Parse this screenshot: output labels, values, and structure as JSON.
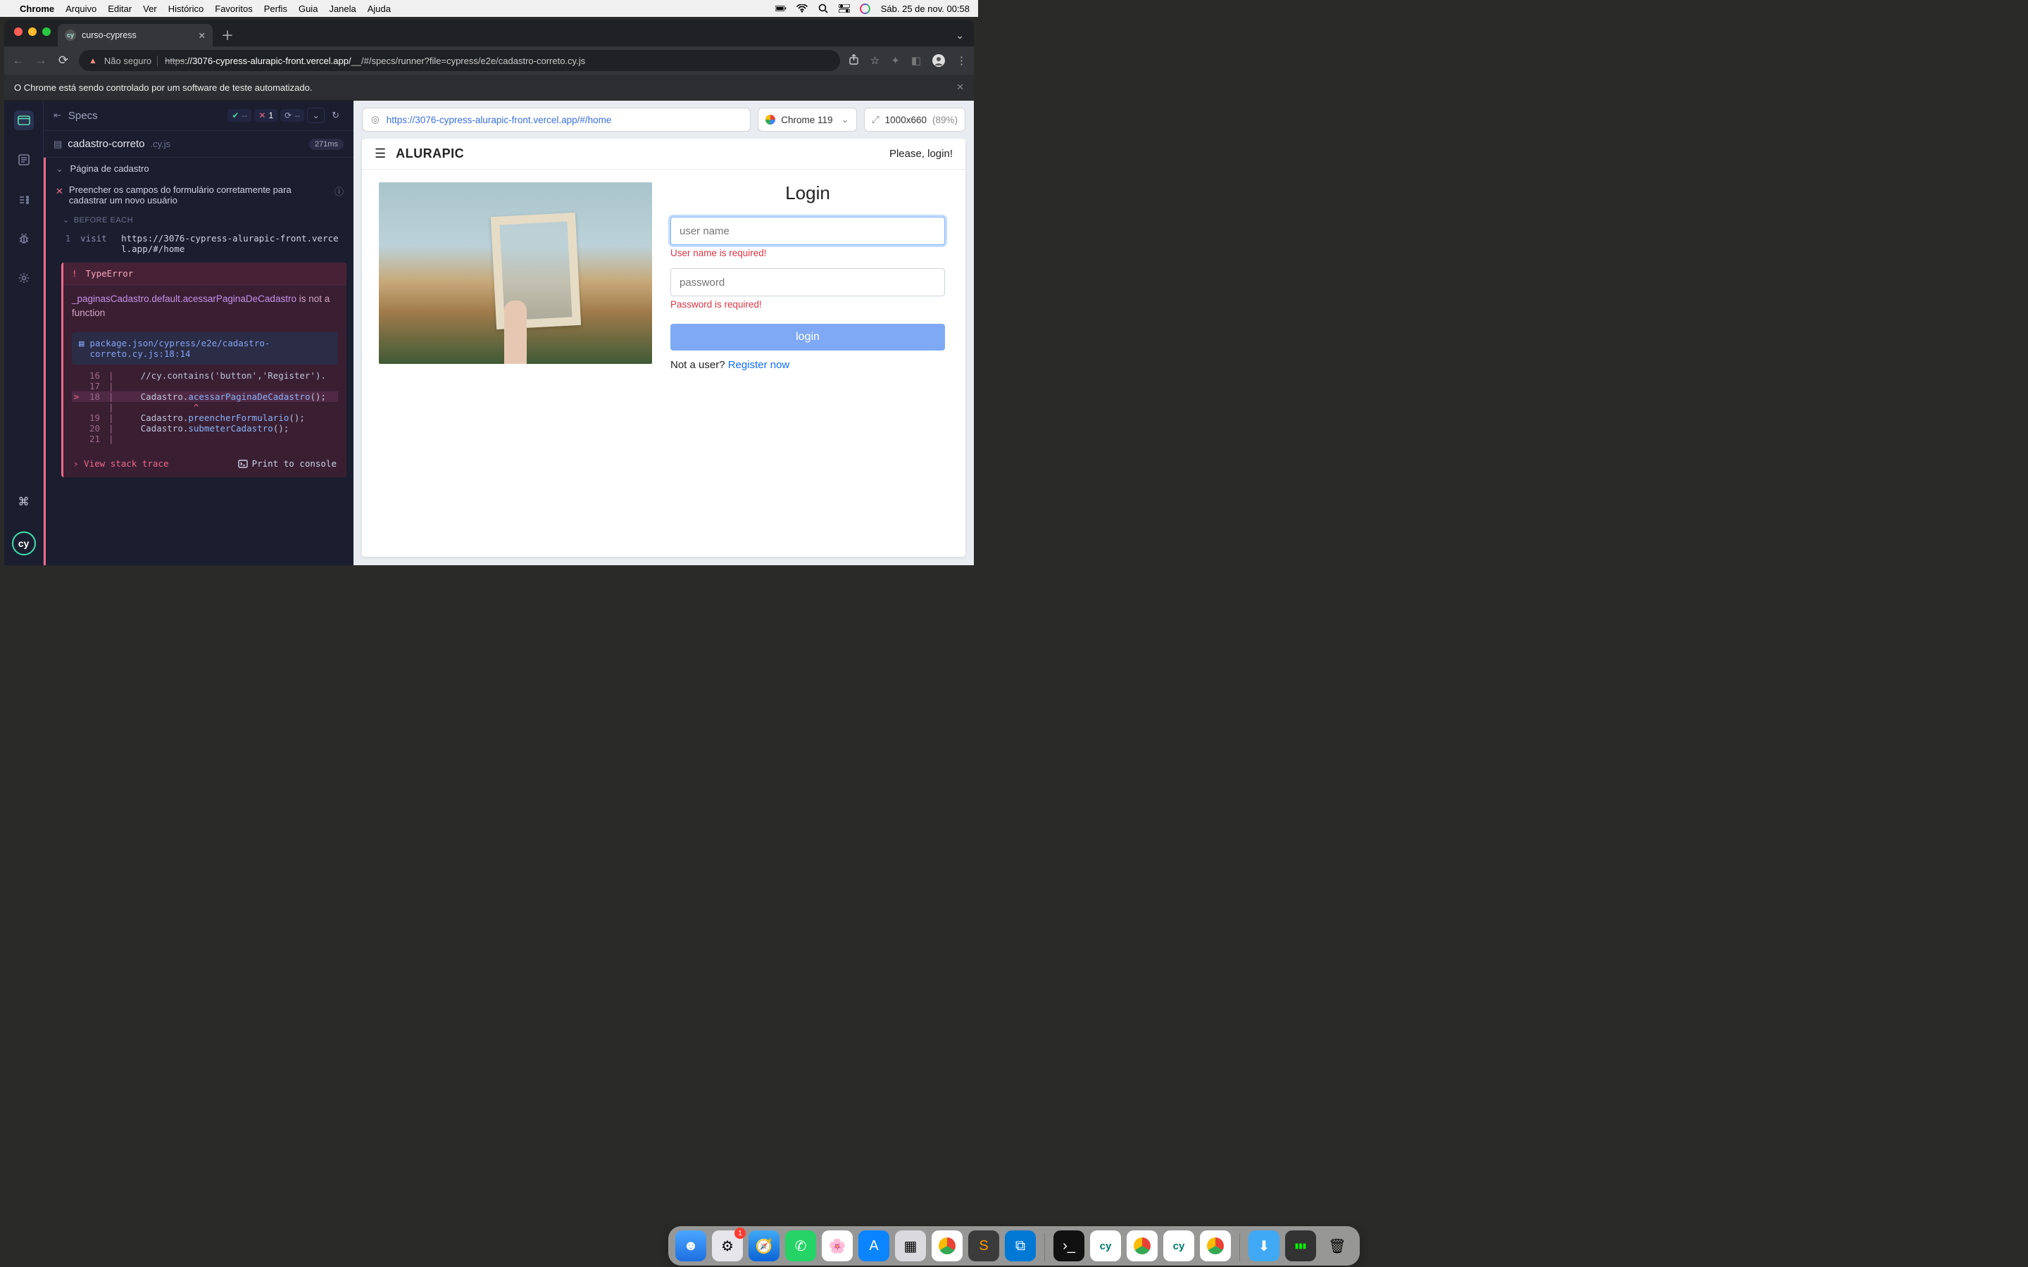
{
  "mac": {
    "app": "Chrome",
    "menus": [
      "Arquivo",
      "Editar",
      "Ver",
      "Histórico",
      "Favoritos",
      "Perfis",
      "Guia",
      "Janela",
      "Ajuda"
    ],
    "clock": "Sáb. 25 de nov.  00:58"
  },
  "chrome": {
    "tab_title": "curso-cypress",
    "security_label": "Não seguro",
    "url_proto": "https",
    "url_host": "://3076-cypress-alurapic-front.vercel.app/",
    "url_path": "__/#/specs/runner?file=cypress/e2e/cadastro-correto.cy.js",
    "automation_msg": "O Chrome está sendo controlado por um software de teste automatizado."
  },
  "cypress": {
    "panel_title": "Specs",
    "pass_count": "--",
    "fail_count": "1",
    "pending_count": "--",
    "file_name": "cadastro-correto",
    "file_ext": ".cy.js",
    "duration": "271ms",
    "describe": "Página de cadastro",
    "test_title": "Preencher os campos do formulário corretamente para cadastrar um novo usuário",
    "before_each_label": "BEFORE EACH",
    "cmd1_num": "1",
    "cmd1_name": "visit",
    "cmd1_arg": "https://3076-cypress-alurapic-front.vercel.app/#/home",
    "error": {
      "type": "TypeError",
      "message_pre": "_paginasCadastro.default.acessarPaginaDeCadastro",
      "message_post": " is not a function",
      "file": "package.json/cypress/e2e/cadastro-correto.cy.js:18:14",
      "code": [
        {
          "n": "16",
          "gt": "",
          "txt": "    //cy.contains('button','Register')."
        },
        {
          "n": "17",
          "gt": "",
          "txt": ""
        },
        {
          "n": "18",
          "gt": ">",
          "txt": "    Cadastro.acessarPaginaDeCadastro();",
          "hl": true,
          "call": "acessarPaginaDeCadastro"
        },
        {
          "n": "",
          "gt": "",
          "txt": "              ^",
          "caret": true
        },
        {
          "n": "19",
          "gt": "",
          "txt": "    Cadastro.preencherFormulario();",
          "call": "preencherFormulario"
        },
        {
          "n": "20",
          "gt": "",
          "txt": "    Cadastro.submeterCadastro();",
          "call": "submeterCadastro"
        },
        {
          "n": "21",
          "gt": "",
          "txt": ""
        }
      ],
      "stack_label": "View stack trace",
      "print_label": "Print to console"
    }
  },
  "preview": {
    "aut_url": "https://3076-cypress-alurapic-front.vercel.app/#/home",
    "browser": "Chrome 119",
    "viewport": "1000x660",
    "scale": "(89%)",
    "brand": "ALURAPIC",
    "please_login": "Please, login!",
    "login_heading": "Login",
    "user_placeholder": "user name",
    "user_error": "User name is required!",
    "pass_placeholder": "password",
    "pass_error": "Password is required!",
    "login_btn": "login",
    "not_user": "Not a user? ",
    "register": "Register now"
  },
  "dock": {
    "badge": "1"
  }
}
